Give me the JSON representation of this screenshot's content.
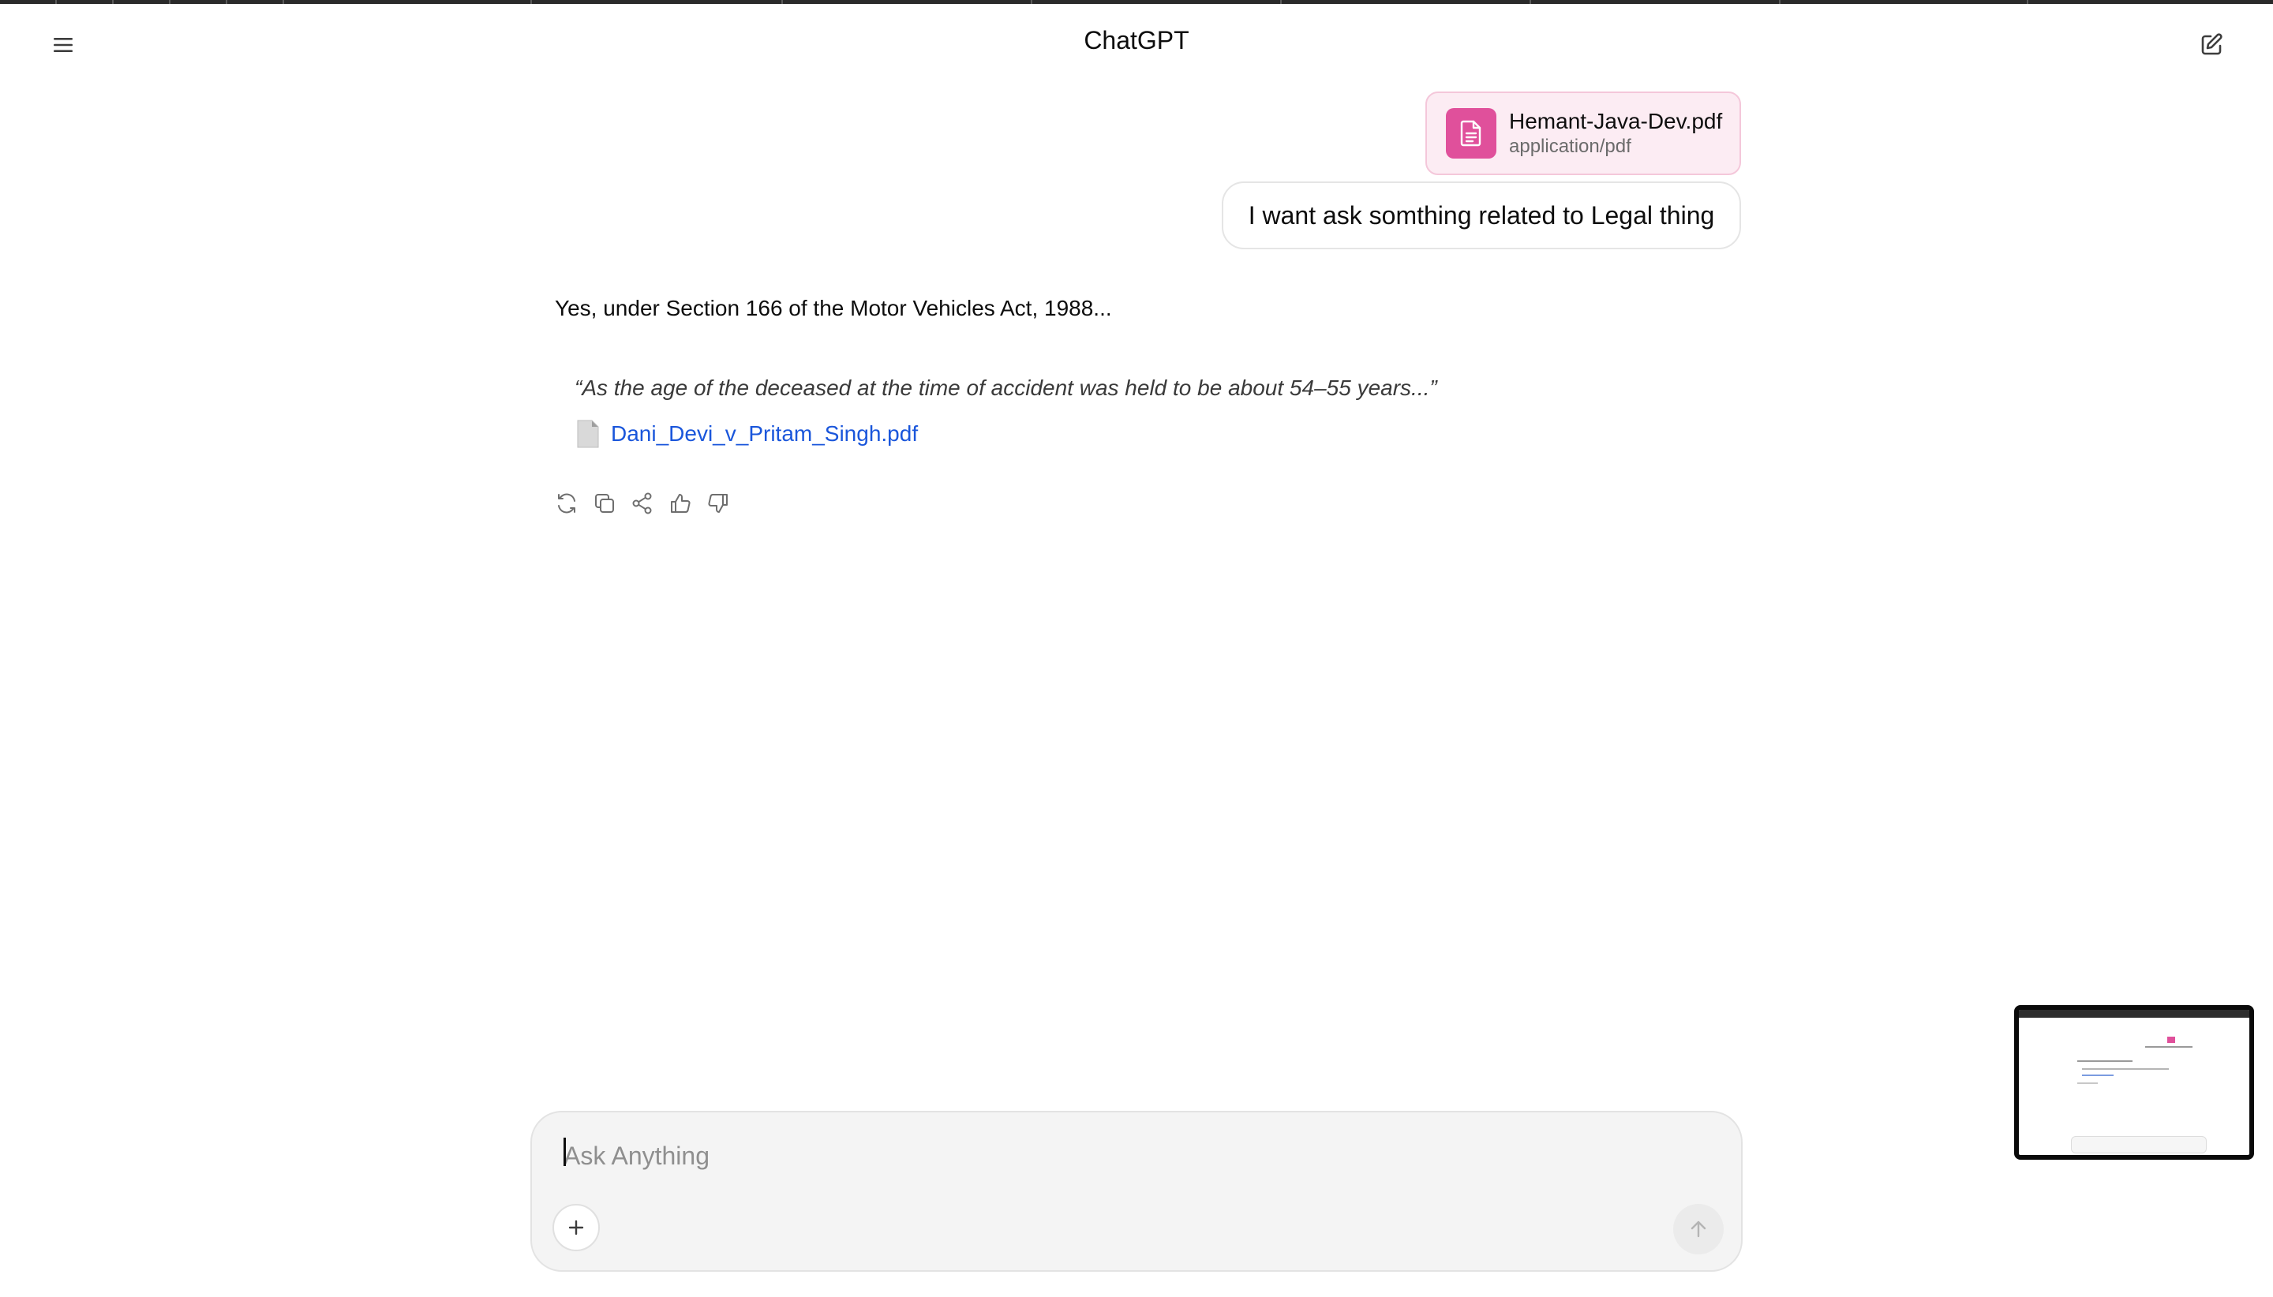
{
  "window": {
    "app_title": "ChatGPT"
  },
  "header": {
    "menu_icon": "hamburger-menu-icon",
    "new_chat_icon": "compose-edit-icon"
  },
  "conversation": {
    "attachment": {
      "file_name": "Hemant-Java-Dev.pdf",
      "file_type": "application/pdf",
      "icon": "document-icon",
      "accent_color": "#e0509b"
    },
    "user_message": "I want ask somthing related to Legal thing",
    "assistant": {
      "text": "Yes, under Section 166 of the Motor Vehicles Act, 1988...",
      "quote": "“As the age of the deceased at the time of accident was held to be about 54–55 years...”",
      "citation_link": "Dani_Devi_v_Pritam_Singh.pdf",
      "citation_icon": "file-icon",
      "actions": [
        "regenerate-icon",
        "copy-icon",
        "share-icon",
        "thumbs-up-icon",
        "thumbs-down-icon"
      ]
    }
  },
  "composer": {
    "placeholder": "Ask Anything",
    "value": "",
    "plus_icon": "plus-icon",
    "send_icon": "arrow-up-icon"
  },
  "colors": {
    "link": "#1a56db",
    "attachment_bg": "#fcecf3",
    "composer_bg": "#f4f4f4"
  }
}
